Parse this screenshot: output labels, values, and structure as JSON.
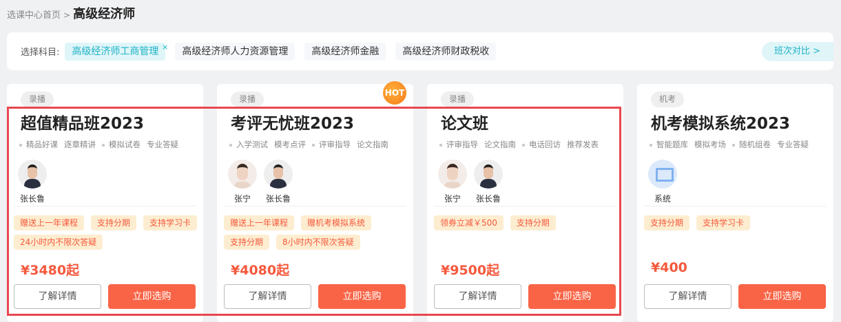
{
  "breadcrumb": {
    "home": "选课中心首页",
    "separator": ">",
    "current": "高级经济师"
  },
  "filter": {
    "label": "选择科目:",
    "subjects": [
      "高级经济师工商管理",
      "高级经济师人力资源管理",
      "高级经济师金融",
      "高级经济师财政税收"
    ],
    "selected_close": "×",
    "compare": "班次对比 >"
  },
  "cards": [
    {
      "badge": "录播",
      "title": "超值精品班2023",
      "features": [
        "精品好课",
        "逐章精讲",
        "模拟试卷",
        "专业答疑"
      ],
      "teachers": [
        "张长鲁"
      ],
      "tags": [
        "赠送上一年课程",
        "支持分期",
        "支持学习卡",
        "24小时内不限次答疑"
      ],
      "price": "¥3480起",
      "detail": "了解详情",
      "buy": "立即选购"
    },
    {
      "badge": "录播",
      "hot": "HOT",
      "title": "考评无忧班2023",
      "features": [
        "入学测试",
        "模考点评",
        "评审指导",
        "论文指南"
      ],
      "teachers": [
        "张宁",
        "张长鲁"
      ],
      "tags": [
        "赠送上一年课程",
        "赠机考模拟系统",
        "支持分期",
        "8小时内不限次答疑"
      ],
      "price": "¥4080起",
      "detail": "了解详情",
      "buy": "立即选购"
    },
    {
      "badge": "录播",
      "title": "论文班",
      "features": [
        "评审指导",
        "论文指南",
        "电话回访",
        "推荐发表"
      ],
      "teachers": [
        "张宁",
        "张长鲁"
      ],
      "tags": [
        "领券立减￥500",
        "支持分期"
      ],
      "price": "¥9500起",
      "detail": "了解详情",
      "buy": "立即选购"
    },
    {
      "badge": "机考",
      "title": "机考模拟系统2023",
      "features": [
        "智能题库",
        "模拟考场",
        "随机组卷",
        "专业答疑"
      ],
      "teachers": [
        "系统"
      ],
      "tags": [
        "支持分期",
        "支持学习卡"
      ],
      "price": "¥400",
      "detail": "了解详情",
      "buy": "立即选购"
    }
  ]
}
